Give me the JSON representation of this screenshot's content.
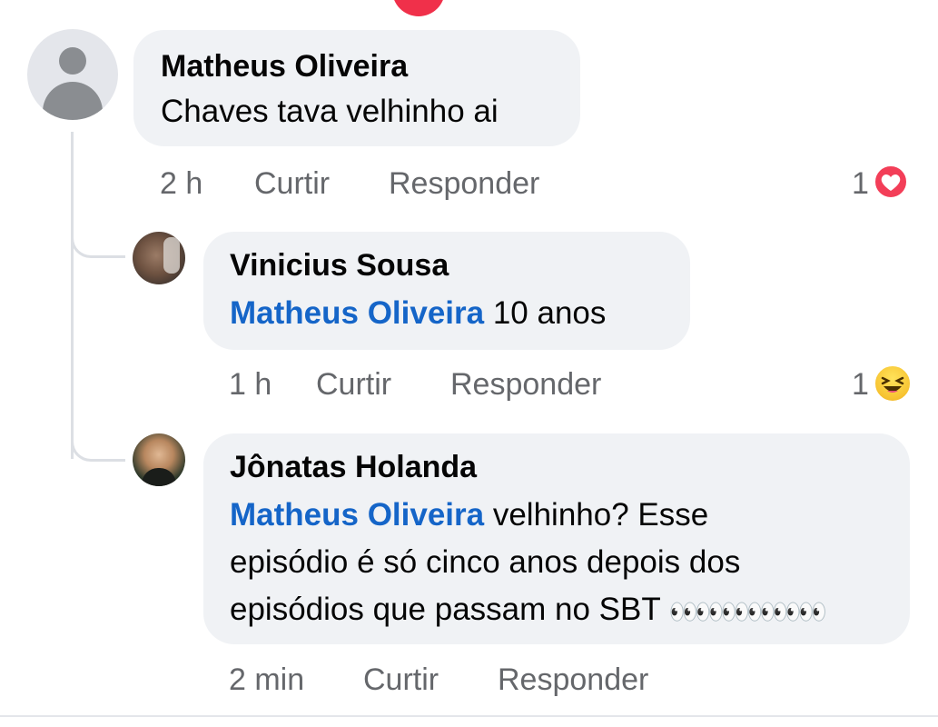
{
  "comment": {
    "author": "Matheus Oliveira",
    "text": "Chaves tava velhinho ai",
    "time": "2 h",
    "like_label": "Curtir",
    "reply_label": "Responder",
    "reaction_count": "1",
    "reaction_icon": "heart-icon"
  },
  "replies": [
    {
      "author": "Vinicius Sousa",
      "mention": "Matheus Oliveira",
      "text": " 10 anos",
      "time": "1 h",
      "like_label": "Curtir",
      "reply_label": "Responder",
      "reaction_count": "1",
      "reaction_icon": "haha-icon"
    },
    {
      "author": "Jônatas Holanda",
      "mention": "Matheus Oliveira",
      "text_line1": " velhinho? Esse",
      "text_line2": "episódio é só cinco anos depois dos",
      "text_line3": "episódios que passam no SBT ",
      "emoji": "👀👀👀👀👀👀",
      "time": "2 min",
      "like_label": "Curtir",
      "reply_label": "Responder"
    }
  ],
  "colors": {
    "bubble": "#f0f2f5",
    "mention": "#1565c8",
    "meta": "#65676b",
    "heart": "#f33e58"
  }
}
